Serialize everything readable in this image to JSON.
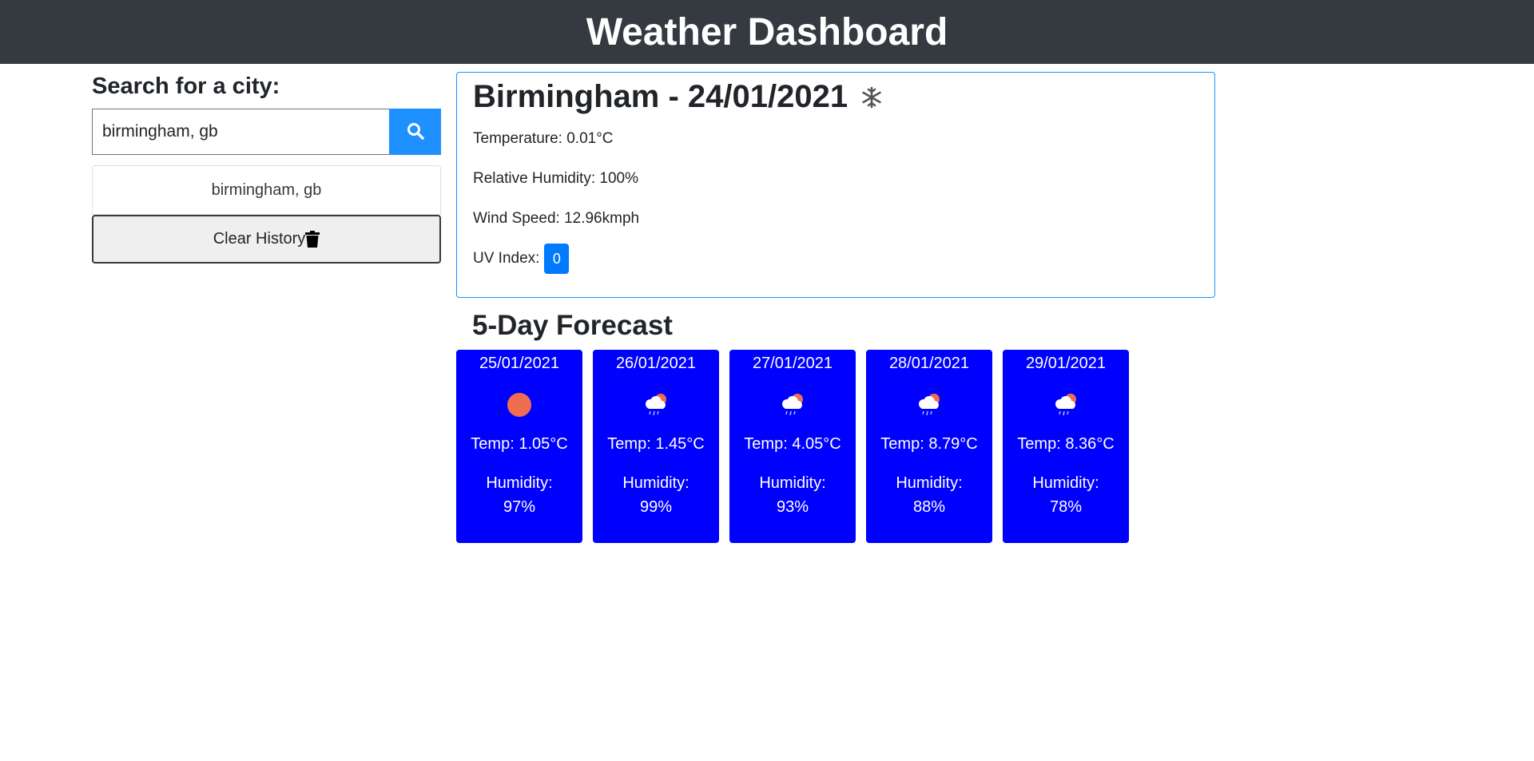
{
  "header": {
    "title": "Weather Dashboard"
  },
  "sidebar": {
    "heading": "Search for a city:",
    "search": {
      "value": "birmingham, gb",
      "placeholder": ""
    },
    "search_icon": "search-icon",
    "history": [
      {
        "label": "birmingham, gb"
      }
    ],
    "clear_label": "Clear History",
    "clear_icon": "trash-icon"
  },
  "current": {
    "title": "Birmingham - 24/01/2021",
    "icon": "snowflake-icon",
    "temperature": "Temperature: 0.01°C",
    "humidity": "Relative Humidity: 100%",
    "wind": "Wind Speed: 12.96kmph",
    "uv_label": "UV Index:",
    "uv_value": "0"
  },
  "forecast": {
    "title": "5-Day Forecast",
    "days": [
      {
        "date": "25/01/2021",
        "icon": "sun-icon",
        "temp": "Temp: 1.05°C",
        "humidity_label": "Humidity:",
        "humidity": "97%"
      },
      {
        "date": "26/01/2021",
        "icon": "rain-cloud-sun-icon",
        "temp": "Temp: 1.45°C",
        "humidity_label": "Humidity:",
        "humidity": "99%"
      },
      {
        "date": "27/01/2021",
        "icon": "rain-cloud-sun-icon",
        "temp": "Temp: 4.05°C",
        "humidity_label": "Humidity:",
        "humidity": "93%"
      },
      {
        "date": "28/01/2021",
        "icon": "rain-cloud-sun-icon",
        "temp": "Temp: 8.79°C",
        "humidity_label": "Humidity:",
        "humidity": "88%"
      },
      {
        "date": "29/01/2021",
        "icon": "rain-cloud-sun-icon",
        "temp": "Temp: 8.36°C",
        "humidity_label": "Humidity:",
        "humidity": "78%"
      }
    ]
  },
  "colors": {
    "navbar": "#343a40",
    "accent": "#1e90ff",
    "forecast_card": "#0000ff",
    "uv_badge": "#007bff"
  }
}
